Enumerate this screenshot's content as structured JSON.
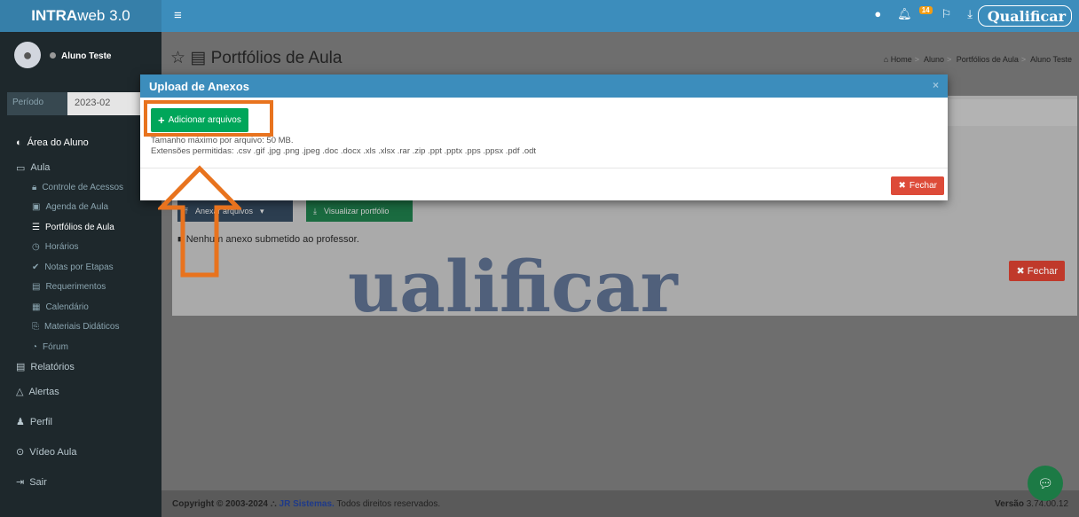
{
  "header": {
    "logo_bold": "INTRA",
    "logo_rest": "web 3.0",
    "alert_count": "14",
    "brand": "Qualificar"
  },
  "sidebar": {
    "user_name": "Aluno Teste",
    "period_label": "Período",
    "period_value": "2023-02",
    "area_title": "Área do Aluno",
    "aula_label": "Aula",
    "sub_items": [
      "Controle de Acessos",
      "Agenda de Aula",
      "Portfólios de Aula",
      "Horários",
      "Notas por Etapas",
      "Requerimentos",
      "Calendário",
      "Materiais Didáticos",
      "Fórum"
    ],
    "relatorios": "Relatórios",
    "alertas": "Alertas",
    "perfil": "Perfil",
    "video_aula": "Vídeo Aula",
    "sair": "Sair"
  },
  "page": {
    "title": "Portfólios de Aula",
    "breadcrumb": [
      "Home",
      "Aluno",
      "Portfólios de Aula",
      "Aluno Teste"
    ],
    "bg_attach": "Anexar arquivos",
    "bg_view": "Visualizar portfólio",
    "bg_none": "Nenhum anexo submetido ao professor.",
    "bg_close": "Fechar",
    "watermark": "ualificar"
  },
  "modal": {
    "title": "Upload de Anexos",
    "add_button": "Adicionar arquivos",
    "max_size": "Tamanho máximo por arquivo: 50 MB.",
    "extensions": "Extensões permitidas: .csv .gif .jpg .png .jpeg .doc .docx .xls .xlsx .rar .zip .ppt .pptx .pps .ppsx .pdf .odt",
    "close_button": "Fechar"
  },
  "footer": {
    "copyright": "Copyright © 2003-2024",
    "company": "JR Sistemas.",
    "rights": "Todos direitos reservados.",
    "version_label": "Versão",
    "version": "3.74.00.12"
  },
  "colors": {
    "header_blue": "#3c8dbc",
    "sidebar_dark": "#1e282c",
    "success_green": "#00a65a",
    "danger_red": "#dd4b39",
    "annotation_orange": "#e8731e"
  }
}
